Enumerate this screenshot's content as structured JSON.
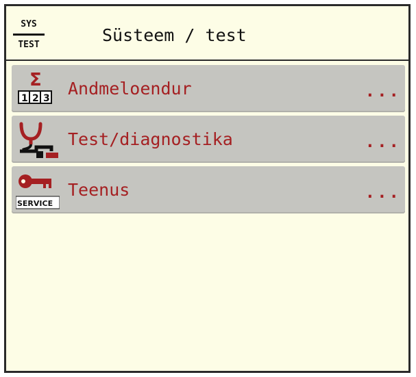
{
  "header": {
    "badge_top": "SYS",
    "badge_bottom": "TEST",
    "title": "Süsteem / test"
  },
  "menu": {
    "items": [
      {
        "label": "Andmeloendur",
        "more": "...",
        "icon": "sigma-counter-icon",
        "icon_text": "Σ",
        "icon_digits": [
          "1",
          "2",
          "3"
        ]
      },
      {
        "label": "Test/diagnostika",
        "more": "...",
        "icon": "stethoscope-icon"
      },
      {
        "label": "Teenus",
        "more": "...",
        "icon": "service-key-icon",
        "icon_text": "SERVICE"
      }
    ]
  },
  "colors": {
    "background": "#fdfde6",
    "item_background": "#c5c5c0",
    "accent": "#a52022",
    "text": "#111111"
  }
}
